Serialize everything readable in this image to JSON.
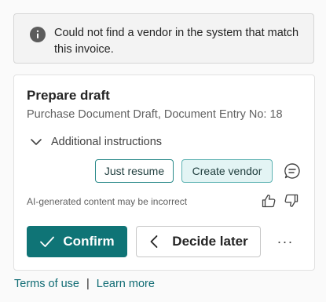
{
  "banner": {
    "icon": "info-icon",
    "message": "Could not find a vendor in the system that match this invoice."
  },
  "card": {
    "title": "Prepare draft",
    "subtitle": "Purchase Document Draft, Document Entry No: 18",
    "additional_instructions": {
      "label": "Additional instructions",
      "icon": "chevron-down-icon",
      "expanded": false
    },
    "chips": [
      {
        "label": "Just resume"
      },
      {
        "label": "Create vendor"
      }
    ],
    "chat_icon": "chat-bubble-icon",
    "disclaimer": "AI-generated content may be incorrect",
    "feedback": {
      "up_icon": "thumbs-up-icon",
      "down_icon": "thumbs-down-icon"
    },
    "actions": {
      "confirm": {
        "label": "Confirm",
        "icon": "checkmark-icon"
      },
      "decide_later": {
        "label": "Decide later",
        "icon": "chevron-left-icon"
      },
      "more_label": "···"
    }
  },
  "footer": {
    "terms": "Terms of use",
    "separator": "|",
    "learn_more": "Learn more"
  },
  "colors": {
    "accent": "#0f7476",
    "link": "#0f6b73",
    "chip_selected_bg": "#e3f4f4",
    "banner_bg": "#f3f3f3"
  }
}
